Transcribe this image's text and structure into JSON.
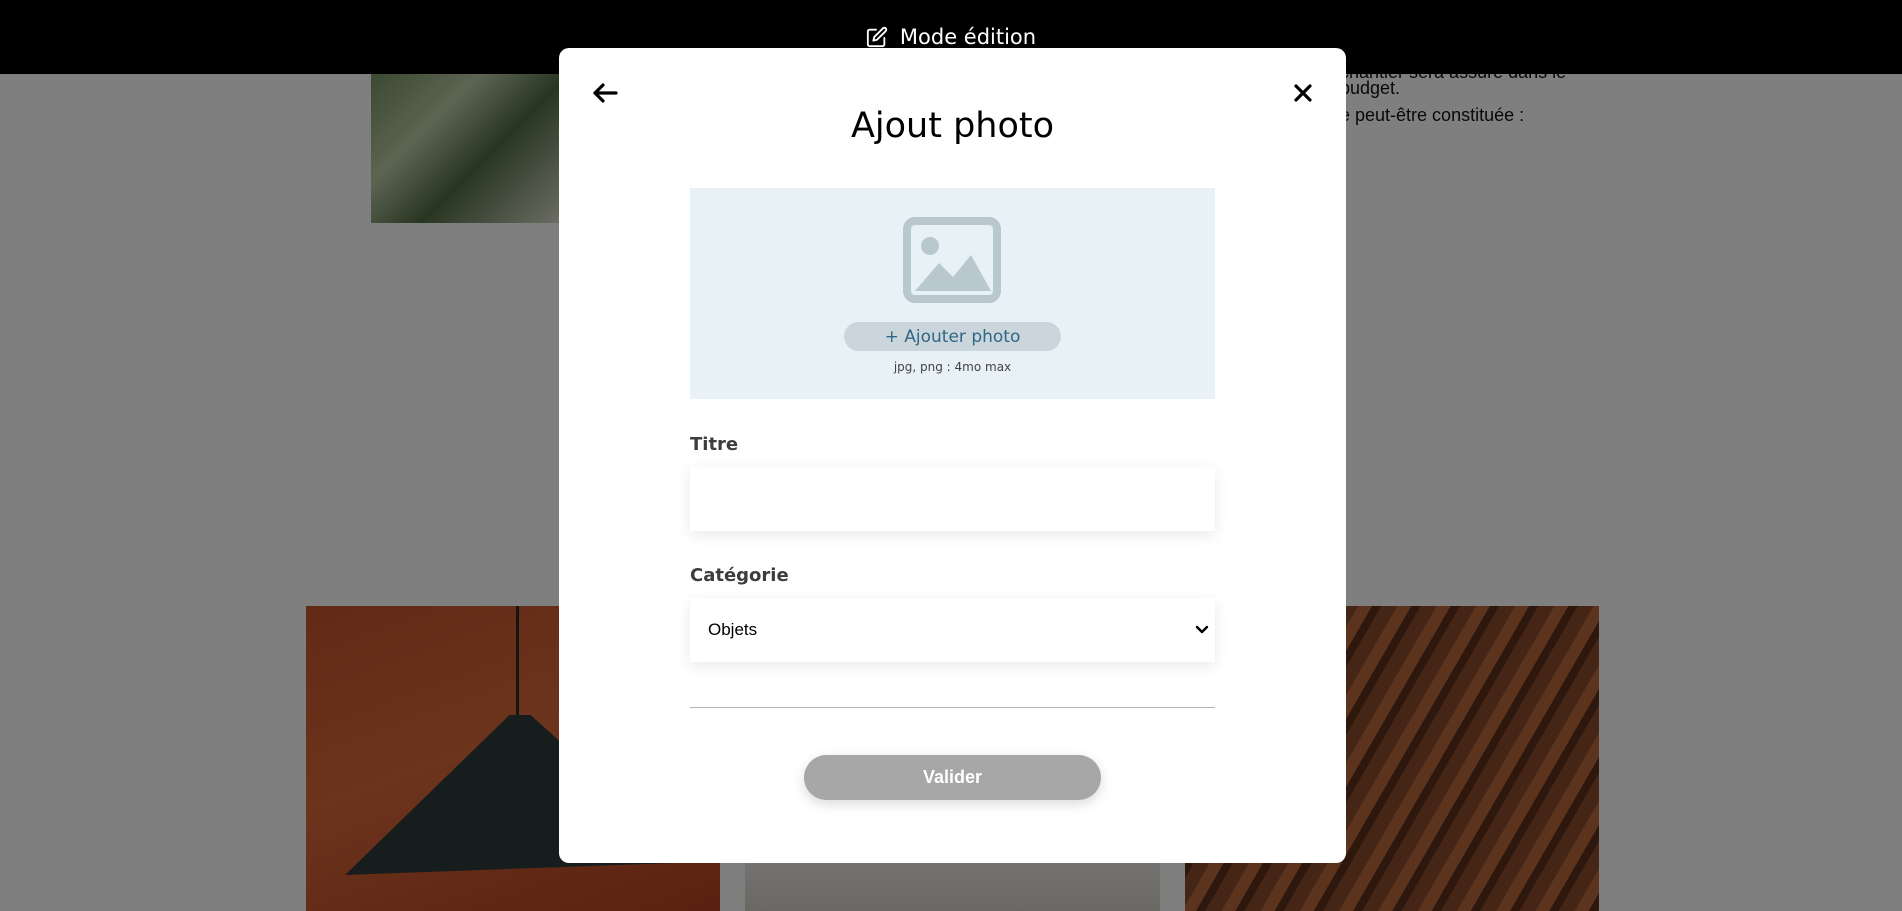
{
  "edit_bar": {
    "icon": "edit-icon",
    "label": "Mode édition"
  },
  "background_text": {
    "line1": "chantier sera assuré dans le",
    "line2": "budget.",
    "line3": "e peut-être constituée :"
  },
  "modal": {
    "back_icon": "arrow-left-icon",
    "close_icon": "close-icon",
    "title": "Ajout photo",
    "upload": {
      "icon": "image-icon",
      "button_label": "+ Ajouter photo",
      "hint": "jpg, png : 4mo max"
    },
    "title_field": {
      "label": "Titre",
      "value": ""
    },
    "category_field": {
      "label": "Catégorie",
      "selected": "Objets"
    },
    "submit_label": "Valider"
  },
  "colors": {
    "modal_bg": "#ffffff",
    "upload_bg": "#e8f1f6",
    "upload_button_bg": "#cbd6dc",
    "upload_button_text": "#306685",
    "submit_disabled": "#a7a7a7",
    "edit_bar": "#000000"
  }
}
